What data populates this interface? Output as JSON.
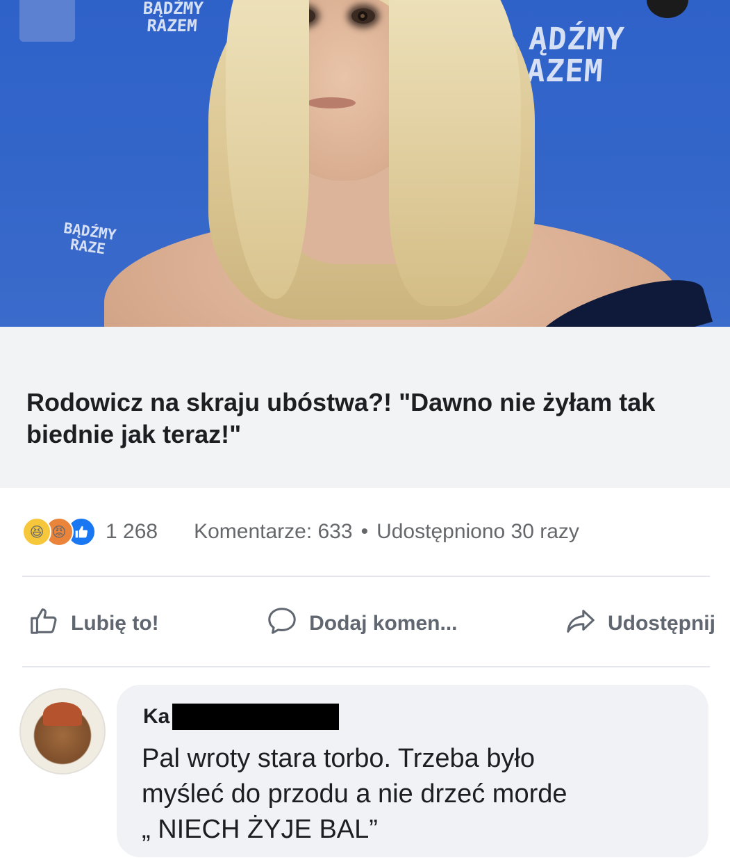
{
  "photo": {
    "wall_text_left": "BĄDŹMY\nRAZEM",
    "wall_text_right": "ĄDŹMY\nAZEM",
    "wall_text_small": "BĄDŹMY\nRAZE"
  },
  "post": {
    "headline": "Rodowicz na skraju ubóstwa?! \"Dawno nie żyłam tak biednie jak teraz!\""
  },
  "stats": {
    "reaction_icons": [
      "haha-reaction-icon",
      "angry-reaction-icon",
      "like-reaction-icon"
    ],
    "reaction_count": "1 268",
    "comments": "Komentarze: 633",
    "separator": "•",
    "shares": "Udostępniono 30 razy"
  },
  "actions": {
    "like": "Lubię to!",
    "comment": "Dodaj komen...",
    "share": "Udostępnij"
  },
  "comment": {
    "author_visible": "Ka",
    "text": "Pal wroty stara torbo. Trzeba było\nmyśleć do przodu a nie drzeć morde\n„ NIECH ŻYJE BAL”"
  },
  "colors": {
    "wall_blue": "#3466c9",
    "text_primary": "#1c1e21",
    "text_secondary": "#65676b",
    "headline_bg": "#f2f3f5",
    "bubble_bg": "#f0f2f5"
  }
}
